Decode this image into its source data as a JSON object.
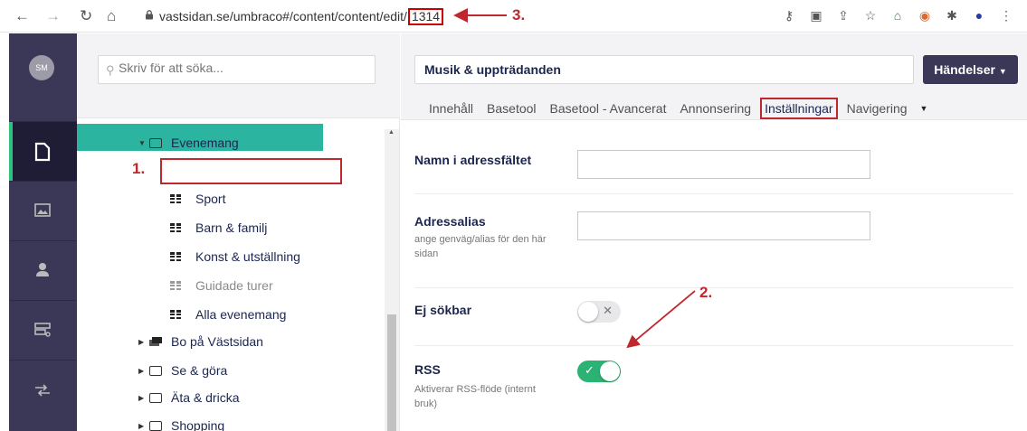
{
  "browser": {
    "url_prefix": "vastsidan.se/umbraco#/content/content/edit/",
    "url_id": "1314",
    "icons": [
      "back-icon",
      "forward-icon",
      "reload-icon",
      "home-icon",
      "lock-icon"
    ]
  },
  "rail": {
    "avatar": "SM",
    "items": [
      "content-icon",
      "media-icon",
      "users-icon",
      "forms-icon",
      "translation-icon"
    ]
  },
  "tree": {
    "search_placeholder": "Skriv för att söka...",
    "parent": "Evenemang",
    "selected": "Musik & uppträdanden",
    "children": [
      "Sport",
      "Barn & familj",
      "Konst & utställning",
      "Guidade turer",
      "Alla evenemang"
    ],
    "siblings": [
      "Bo på Västsidan",
      "Se & göra",
      "Äta & dricka",
      "Shopping"
    ]
  },
  "content": {
    "node_name": "Musik & uppträdanden",
    "actions_label": "Händelser",
    "tabs": [
      "Innehåll",
      "Basetool",
      "Basetool - Avancerat",
      "Annonsering",
      "Inställningar",
      "Navigering"
    ],
    "active_tab": "Inställningar",
    "properties": {
      "url_name": {
        "label": "Namn i adressfältet",
        "value": ""
      },
      "url_alias": {
        "label": "Adressalias",
        "description": "ange genväg/alias för den här sidan",
        "value": ""
      },
      "hide_search": {
        "label": "Ej sökbar",
        "state": "off"
      },
      "rss": {
        "label": "RSS",
        "description": "Aktiverar RSS-flöde (internt bruk)",
        "state": "on"
      }
    }
  },
  "annotations": {
    "one": "1.",
    "two": "2.",
    "three": "3."
  },
  "colors": {
    "rail": "#3b3756",
    "selected": "#2bb4a0",
    "toggle_on": "#2bb373",
    "annotation": "#c0272d"
  }
}
